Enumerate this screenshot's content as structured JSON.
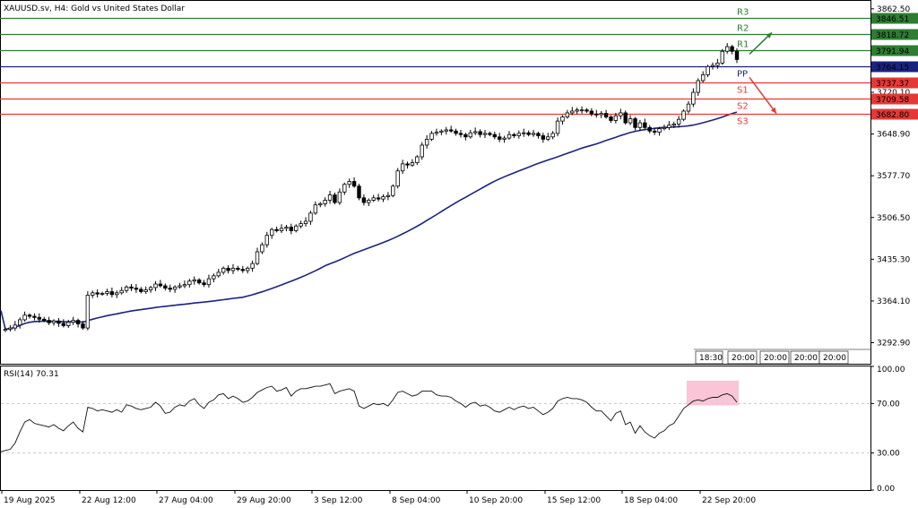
{
  "header": {
    "title": "XAUUSD.sv, H4:  Gold vs United States Dollar"
  },
  "rsi_panel": {
    "title": "RSI(14) 70.31"
  },
  "colors": {
    "candle_body": "#ffffff",
    "candle_border": "#000000",
    "ma": "#1a237e",
    "resistance": "#2e7d32",
    "support": "#e53935",
    "pivot": "#1a237e",
    "rsi_highlight": "#f8bbd0"
  },
  "chart_data": [
    {
      "type": "candlestick",
      "ylim": [
        3257,
        3876
      ],
      "y_ticks": [
        3292.9,
        3364.1,
        3435.3,
        3506.5,
        3577.7,
        3648.9,
        3720.1,
        3862.5
      ],
      "x_tick_labels": [
        "19 Aug 2025",
        "22 Aug 12:00",
        "27 Aug 04:00",
        "29 Aug 20:00",
        "3 Sep 12:00",
        "8 Sep 04:00",
        "10 Sep 20:00",
        "15 Sep 12:00",
        "18 Sep 04:00",
        "22 Sep 20:00"
      ],
      "mini_time_labels": [
        "18:30",
        "20:00",
        "20:00",
        "20:00",
        "20:00"
      ],
      "candles_close": [
        3316,
        3318,
        3323,
        3332,
        3340,
        3338,
        3336,
        3333,
        3331,
        3327,
        3330,
        3326,
        3322,
        3328,
        3331,
        3325,
        3318,
        3374,
        3378,
        3376,
        3377,
        3380,
        3375,
        3378,
        3382,
        3388,
        3386,
        3384,
        3380,
        3383,
        3387,
        3393,
        3390,
        3386,
        3384,
        3388,
        3390,
        3392,
        3398,
        3400,
        3395,
        3392,
        3402,
        3407,
        3413,
        3420,
        3416,
        3420,
        3418,
        3416,
        3420,
        3428,
        3448,
        3460,
        3476,
        3486,
        3484,
        3488,
        3490,
        3484,
        3492,
        3496,
        3500,
        3514,
        3528,
        3530,
        3536,
        3545,
        3532,
        3550,
        3563,
        3568,
        3560,
        3540,
        3532,
        3536,
        3540,
        3538,
        3542,
        3544,
        3560,
        3586,
        3598,
        3596,
        3600,
        3610,
        3630,
        3640,
        3650,
        3652,
        3654,
        3656,
        3654,
        3650,
        3648,
        3644,
        3651,
        3653,
        3648,
        3650,
        3648,
        3644,
        3640,
        3642,
        3648,
        3646,
        3650,
        3651,
        3648,
        3650,
        3646,
        3640,
        3644,
        3650,
        3671,
        3678,
        3685,
        3688,
        3690,
        3690,
        3688,
        3683,
        3682,
        3684,
        3678,
        3672,
        3680,
        3685,
        3668,
        3675,
        3660,
        3668,
        3660,
        3654,
        3652,
        3658,
        3660,
        3664,
        3666,
        3674,
        3688,
        3700,
        3720,
        3740,
        3750,
        3764,
        3766,
        3770,
        3790,
        3798,
        3790,
        3776
      ],
      "pivot_levels": [
        {
          "name": "R3",
          "value": 3846.51,
          "kind": "resistance"
        },
        {
          "name": "R2",
          "value": 3818.72,
          "kind": "resistance"
        },
        {
          "name": "R1",
          "value": 3791.94,
          "kind": "resistance"
        },
        {
          "name": "PP",
          "value": 3764.15,
          "kind": "pivot"
        },
        {
          "name": "S1",
          "value": 3737.37,
          "kind": "support"
        },
        {
          "name": "S2",
          "value": 3709.58,
          "kind": "support"
        },
        {
          "name": "S3",
          "value": 3682.8,
          "kind": "support"
        }
      ]
    },
    {
      "type": "line",
      "name": "RSI(14)",
      "value": 70.31,
      "ylim": [
        0,
        100
      ],
      "y_ticks": [
        0.0,
        30.0,
        70.0,
        100.0
      ],
      "values": [
        32,
        33,
        38,
        47,
        55,
        57,
        54,
        53,
        52,
        51,
        53,
        50,
        48,
        52,
        55,
        50,
        47,
        67,
        66,
        64,
        65,
        64,
        63,
        65,
        63,
        69,
        68,
        66,
        65,
        66,
        67,
        71,
        68,
        62,
        63,
        67,
        69,
        68,
        72,
        74,
        69,
        66,
        71,
        73,
        77,
        78,
        74,
        76,
        74,
        71,
        72,
        75,
        79,
        81,
        83,
        84,
        80,
        81,
        83,
        76,
        80,
        82,
        82,
        83,
        84,
        84,
        85,
        86,
        78,
        80,
        81,
        82,
        80,
        68,
        66,
        68,
        70,
        69,
        70,
        68,
        73,
        79,
        80,
        78,
        76,
        77,
        80,
        80,
        80,
        77,
        76,
        76,
        75,
        72,
        70,
        67,
        70,
        71,
        68,
        69,
        67,
        64,
        63,
        65,
        67,
        65,
        67,
        68,
        66,
        67,
        64,
        61,
        63,
        66,
        72,
        74,
        75,
        74,
        74,
        73,
        71,
        67,
        64,
        64,
        60,
        56,
        62,
        64,
        53,
        55,
        46,
        52,
        47,
        44,
        42,
        46,
        48,
        52,
        54,
        60,
        66,
        69,
        72,
        73,
        72,
        74,
        75,
        75,
        77,
        78,
        76,
        71
      ]
    }
  ]
}
